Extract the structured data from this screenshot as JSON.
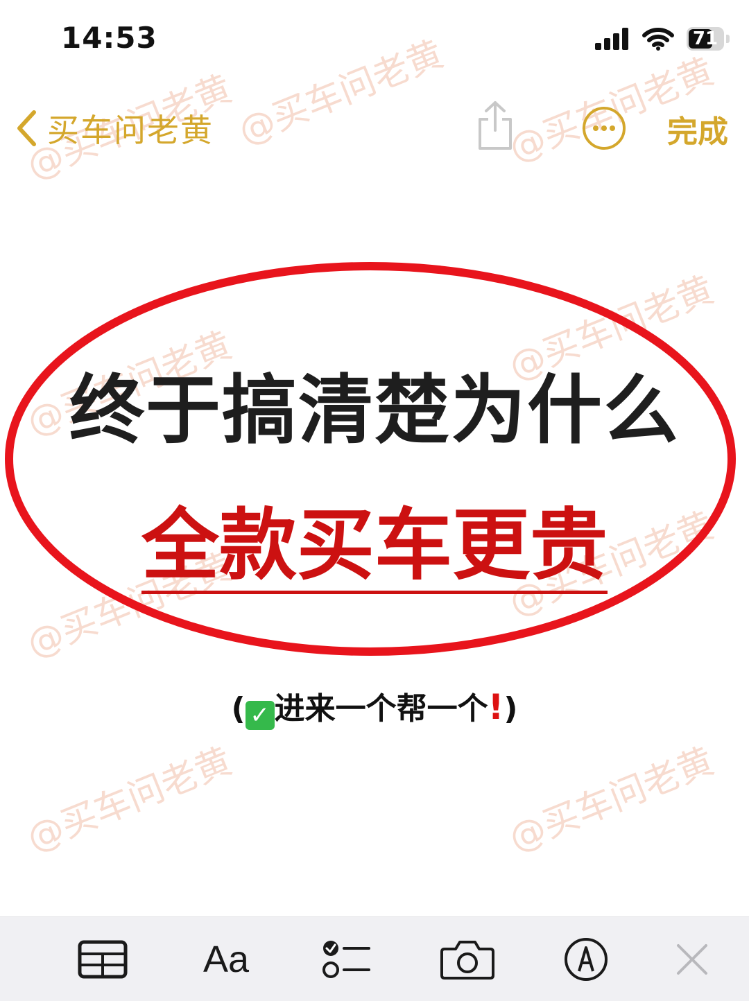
{
  "status_bar": {
    "time": "14:53",
    "battery_text": "71",
    "battery_level": 0.71
  },
  "nav": {
    "back_label": "买车问老黄",
    "done_label": "完成",
    "accent_color": "#d4a72c"
  },
  "note": {
    "headline": "终于搞清楚为什么",
    "subheadline": "全款买车更贵",
    "caption_open": "(",
    "caption_text": "进来一个帮一个",
    "caption_close": ")",
    "highlight_color": "#cc1111"
  },
  "watermark": {
    "text": "@买车问老黄"
  },
  "toolbar": {
    "format_label": "Aa",
    "icons": [
      "table-icon",
      "format-text-icon",
      "checklist-icon",
      "camera-icon",
      "markup-icon",
      "close-icon"
    ]
  }
}
